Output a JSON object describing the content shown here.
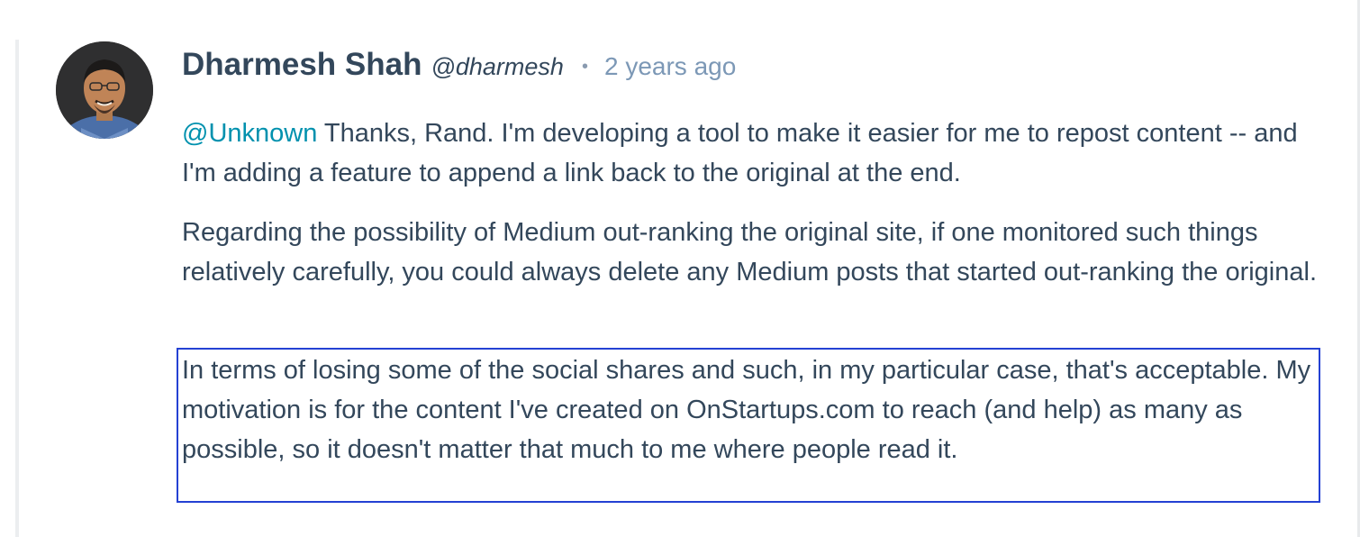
{
  "comment": {
    "author_name": "Dharmesh Shah",
    "author_handle": "@dharmesh",
    "separator": "•",
    "timestamp": "2 years ago",
    "mention": "@Unknown",
    "paragraph1_text": " Thanks, Rand.  I'm developing a tool to make it easier for me to repost content -- and I'm adding a feature to append a link back to the original at the end.",
    "paragraph2": "Regarding the possibility of Medium out-ranking the original site, if one monitored such things relatively carefully, you could always delete any Medium posts that started out-ranking the original.",
    "paragraph3": "In terms of losing some of the social shares and such, in my particular case, that's acceptable.  My motivation is for the content I've created on OnStartups.com to reach (and help) as many as possible, so it doesn't matter that much to me where people read it."
  },
  "colors": {
    "text": "#33475b",
    "mention": "#0091ae",
    "timestamp": "#7c98b6",
    "selection_border": "#2441d3"
  },
  "icons": {
    "avatar": "user-photo"
  }
}
